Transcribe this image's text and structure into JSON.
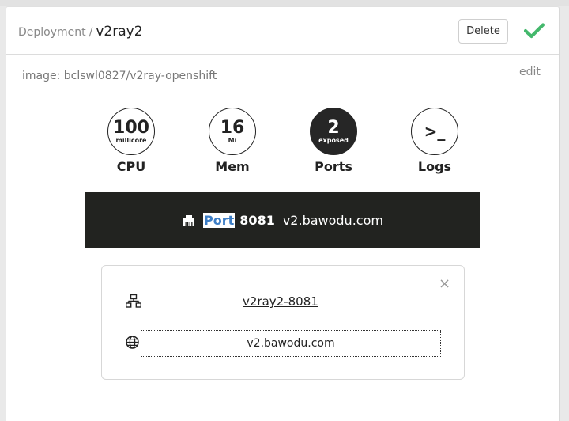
{
  "breadcrumb": {
    "section": "Deployment",
    "separator": "/",
    "name": "v2ray2"
  },
  "toolbar": {
    "delete_label": "Delete",
    "confirm_icon": "check-icon"
  },
  "image_line": "image: bclswl0827/v2ray-openshift",
  "edit_label": "edit",
  "stats": [
    {
      "value": "100",
      "unit": "millicore",
      "label": "CPU",
      "active": false
    },
    {
      "value": "16",
      "unit": "Mi",
      "label": "Mem",
      "active": false
    },
    {
      "value": "2",
      "unit": "exposed",
      "label": "Ports",
      "active": true
    },
    {
      "value": ">_",
      "unit": "",
      "label": "Logs",
      "active": false
    }
  ],
  "port_bar": {
    "icon": "ethernet-icon",
    "word": "Port",
    "number": "8081",
    "host": "v2.bawodu.com"
  },
  "port_panel": {
    "close_glyph": "×",
    "service_icon": "network-icon",
    "service_name": "v2ray2-8081",
    "host_icon": "globe-icon",
    "host_value": "v2.bawodu.com"
  },
  "colors": {
    "check": "#44b86c",
    "highlight_text": "#3d7ec6",
    "dark_bar": "#222320"
  }
}
